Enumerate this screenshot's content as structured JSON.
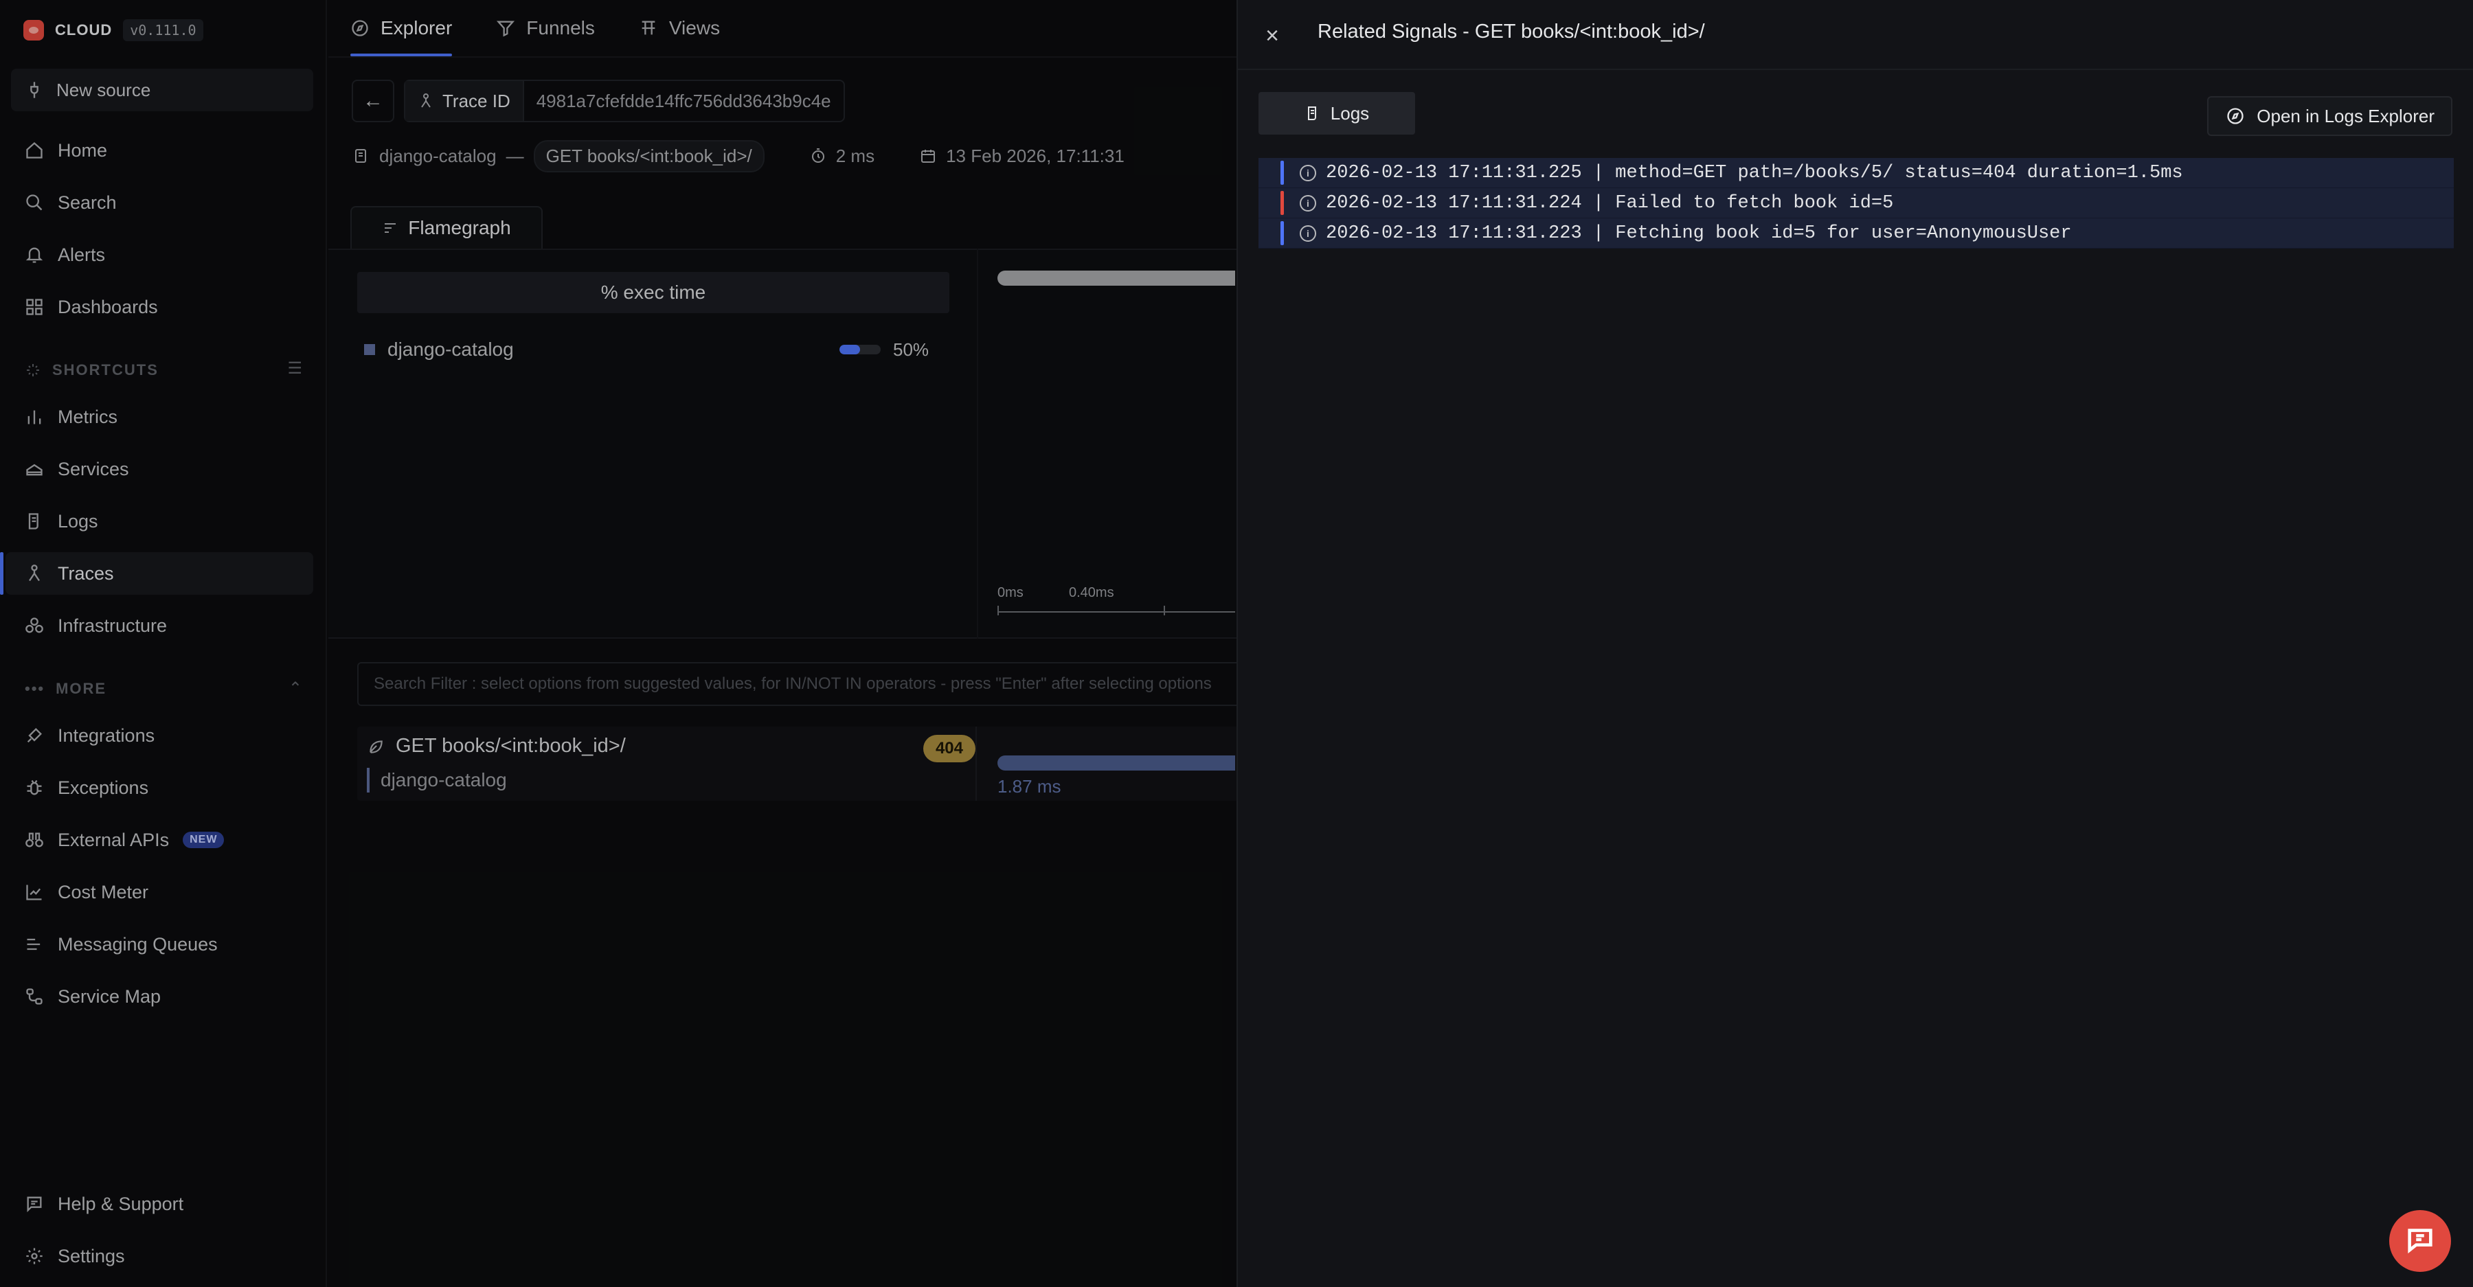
{
  "sidebar": {
    "logo_text": "CLOUD",
    "version": "v0.111.0",
    "new_source": "New source",
    "items_top": [
      {
        "label": "Home",
        "icon": "home-icon"
      },
      {
        "label": "Search",
        "icon": "search-icon"
      },
      {
        "label": "Alerts",
        "icon": "bell-icon"
      },
      {
        "label": "Dashboards",
        "icon": "grid-icon"
      }
    ],
    "shortcuts_label": "SHORTCUTS",
    "shortcuts": [
      {
        "label": "Metrics",
        "icon": "bar-chart-icon"
      },
      {
        "label": "Services",
        "icon": "layers-icon"
      },
      {
        "label": "Logs",
        "icon": "scroll-icon"
      },
      {
        "label": "Traces",
        "icon": "route-icon"
      },
      {
        "label": "Infrastructure",
        "icon": "boxes-icon"
      }
    ],
    "more_label": "MORE",
    "more": [
      {
        "label": "Integrations",
        "icon": "plug-icon"
      },
      {
        "label": "Exceptions",
        "icon": "bug-icon"
      },
      {
        "label": "External APIs",
        "icon": "binoculars-icon",
        "badge": "NEW"
      },
      {
        "label": "Cost Meter",
        "icon": "chart-line-icon"
      },
      {
        "label": "Messaging Queues",
        "icon": "list-icon"
      },
      {
        "label": "Service Map",
        "icon": "map-icon"
      }
    ],
    "help": "Help & Support",
    "settings": "Settings"
  },
  "main": {
    "tabs": [
      {
        "label": "Explorer"
      },
      {
        "label": "Funnels"
      },
      {
        "label": "Views"
      }
    ],
    "trace_id_label": "Trace ID",
    "trace_id": "4981a7cfefdde14ffc756dd3643b9c4e",
    "meta": {
      "service": "django-catalog",
      "dash": "—",
      "route": "GET books/<int:book_id>/",
      "duration": "2 ms",
      "timestamp": "13 Feb 2026, 17:11:31"
    },
    "flamegraph_tab": "Flamegraph",
    "exec_header": "% exec time",
    "exec_service": "django-catalog",
    "exec_pct": "50%",
    "exec_fraction": 0.5,
    "axis_labels": [
      "0ms",
      "0.40ms"
    ],
    "search_placeholder": "Search Filter : select options from suggested values, for IN/NOT IN operators - press \"Enter\" after selecting options",
    "span": {
      "name": "GET books/<int:book_id>/",
      "service": "django-catalog",
      "status": "404",
      "duration": "1.87 ms"
    }
  },
  "drawer": {
    "title": "Related Signals - GET books/<int:book_id>/",
    "logs_tab": "Logs",
    "open_button": "Open in Logs Explorer",
    "logs": [
      {
        "text": "2026-02-13 17:11:31.225 | method=GET path=/books/5/ status=404 duration=1.5ms",
        "color": "#4e74f8"
      },
      {
        "text": "2026-02-13 17:11:31.224 | Failed to fetch book id=5",
        "color": "#e0483e"
      },
      {
        "text": "2026-02-13 17:11:31.223 | Fetching book id=5 for user=AnonymousUser",
        "color": "#4e74f8"
      }
    ]
  },
  "colors": {
    "accent": "#4e74f8",
    "brand": "#e0483e",
    "status_404": "#a78a3e"
  }
}
